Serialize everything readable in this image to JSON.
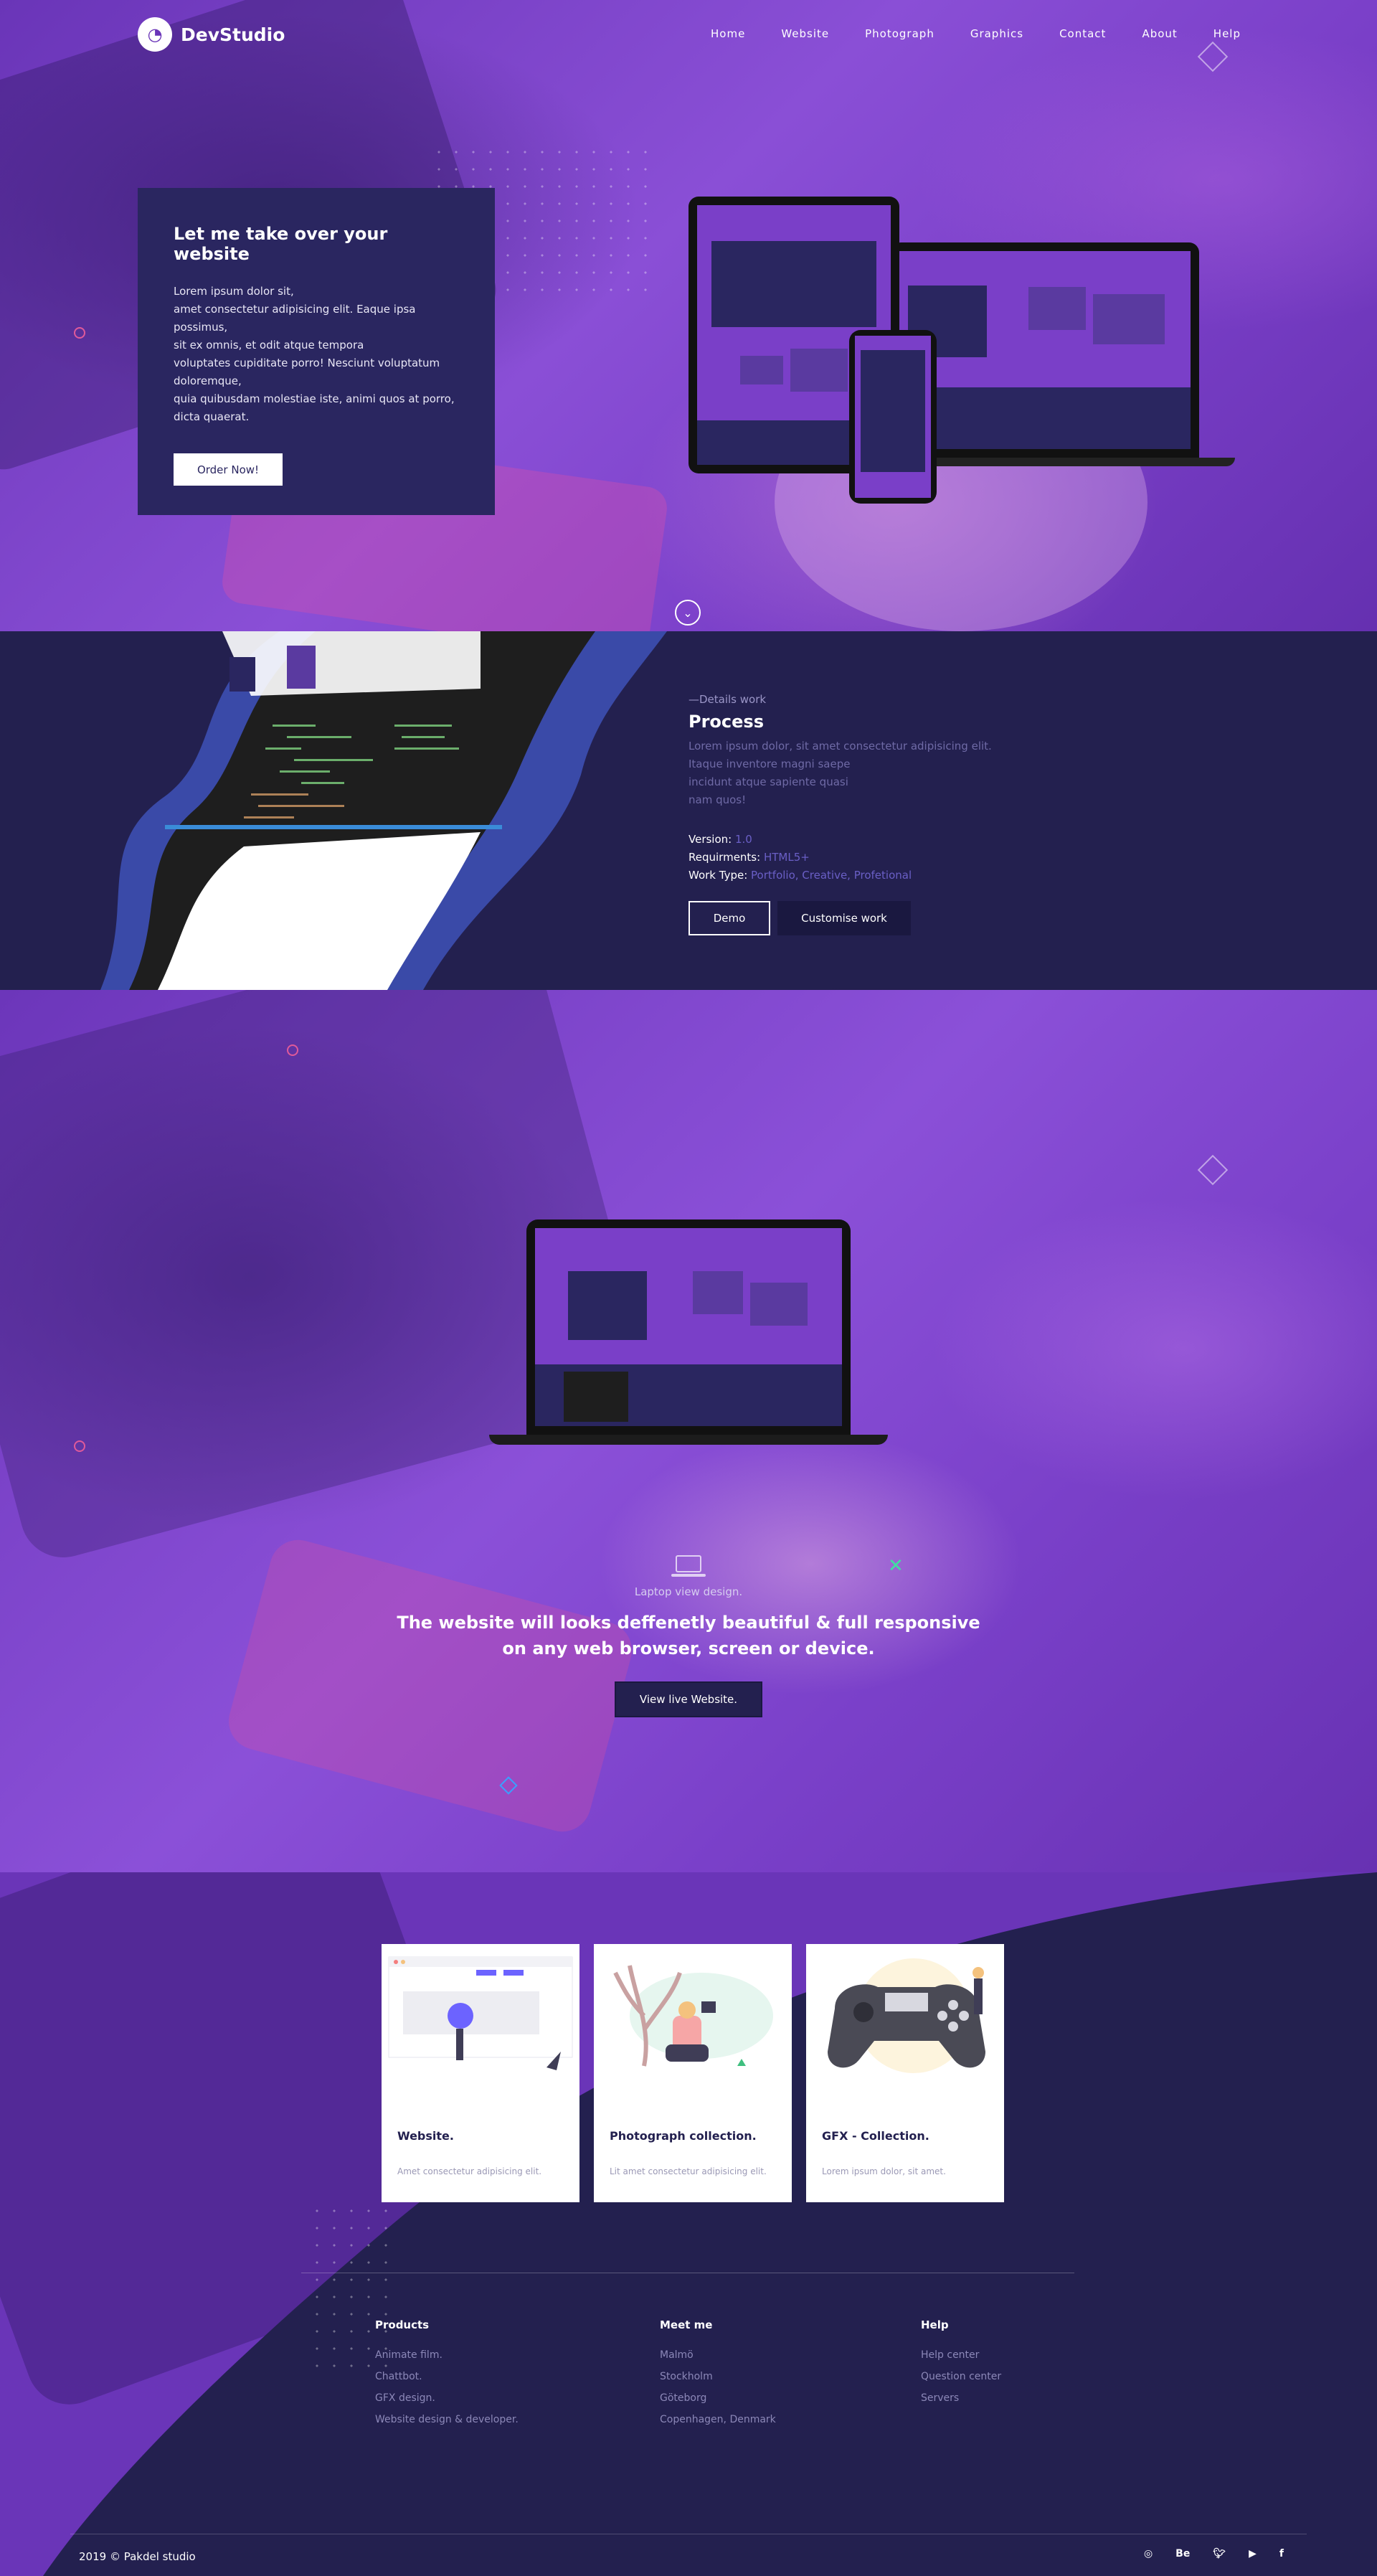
{
  "brand": {
    "name": "DevStudio",
    "logo_glyph": "◔"
  },
  "nav": [
    "Home",
    "Website",
    "Photograph",
    "Graphics",
    "Contact",
    "About",
    "Help"
  ],
  "hero": {
    "title": "Let me take over your website",
    "body": "Lorem ipsum dolor sit,\namet consectetur adipisicing elit. Eaque ipsa possimus,\nsit ex omnis, et odit atque tempora\nvoluptates cupiditate porro! Nesciunt voluptatum doloremque,\nquia quibusdam molestiae iste, animi quos at porro,\ndicta quaerat.",
    "cta": "Order Now!",
    "scroll_icon": "chevron-down-icon"
  },
  "details": {
    "eyebrow": "—Details work",
    "title": "Process",
    "desc": "Lorem ipsum dolor, sit amet consectetur adipisicing elit.\nItaque inventore magni saepe\nincidunt atque sapiente quasi\nnam quos!",
    "version_label": "Version:",
    "version_value": "1.0",
    "req_label": "Requirments:",
    "req_value": "HTML5+",
    "type_label": "Work Type:",
    "type_value": "Portfolio, Creative, Profetional",
    "demo": "Demo",
    "customise": "Customise work"
  },
  "showcase": {
    "caption": "Laptop view design.",
    "headline": "The website will looks deffenetly beautiful & full responsive\non any web browser, screen or device.",
    "cta": "View live Website."
  },
  "cards": [
    {
      "title": "Website.",
      "desc": "Amet consectetur adipisicing elit."
    },
    {
      "title": "Photograph collection.",
      "desc": "Lit amet consectetur adipisicing elit."
    },
    {
      "title": "GFX - Collection.",
      "desc": "Lorem ipsum dolor, sit amet."
    }
  ],
  "footer": {
    "cols": [
      {
        "title": "Products",
        "items": [
          "Animate film.",
          "Chattbot.",
          "GFX design.",
          "Website design & developer."
        ]
      },
      {
        "title": "Meet me",
        "items": [
          "Malmö",
          "Stockholm",
          "Göteborg",
          "Copenhagen, Denmark"
        ]
      },
      {
        "title": "Help",
        "items": [
          "Help center",
          "Question center",
          "Servers"
        ]
      }
    ],
    "copyright": "2019 © Pakdel studio",
    "socials": [
      "instagram-icon",
      "behance-icon",
      "twitter-icon",
      "youtube-icon",
      "facebook-icon"
    ],
    "social_glyphs": [
      "◎",
      "Be",
      "🐦︎",
      "▶",
      "f"
    ]
  },
  "colors": {
    "purple": "#7a3fc8",
    "navy": "#23204f",
    "accent": "#6a5fc6"
  }
}
